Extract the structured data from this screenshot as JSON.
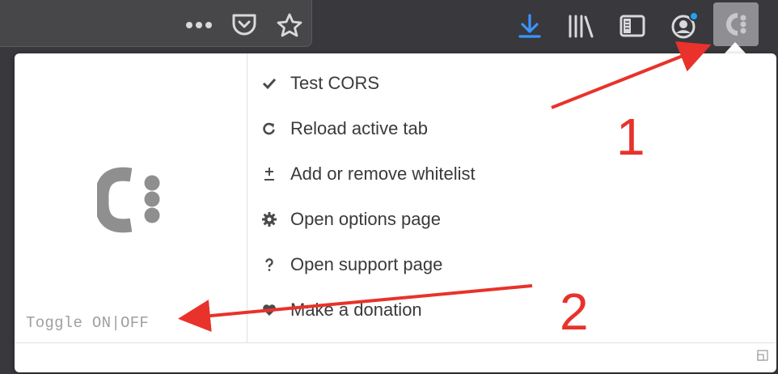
{
  "toolbar": {
    "icons": [
      "page-actions-icon",
      "pocket-icon",
      "bookmark-star-icon",
      "downloads-icon",
      "library-icon",
      "sidebar-icon",
      "account-icon",
      "cors-extension-icon"
    ],
    "download_color": "#3a94ff",
    "badge_color": "#1fa3f2"
  },
  "popup": {
    "toggle_label": "Toggle ON|OFF",
    "menu": [
      {
        "icon": "check-icon",
        "label": "Test CORS"
      },
      {
        "icon": "reload-icon",
        "label": "Reload active tab"
      },
      {
        "icon": "plus-minus-icon",
        "label": "Add or remove whitelist"
      },
      {
        "icon": "gear-icon",
        "label": "Open options page"
      },
      {
        "icon": "question-icon",
        "label": "Open support page"
      },
      {
        "icon": "heart-icon",
        "label": "Make a donation"
      }
    ]
  },
  "annotations": {
    "label_1": "1",
    "label_2": "2",
    "color": "#e8322b"
  }
}
